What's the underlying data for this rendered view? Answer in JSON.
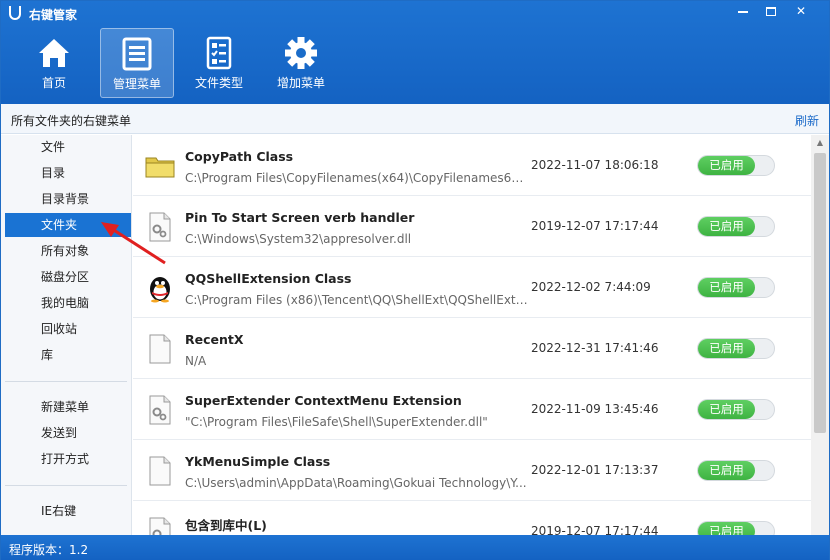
{
  "app": {
    "title": "右键管家"
  },
  "toolbar": {
    "items": [
      {
        "label": "首页",
        "icon": "home-icon"
      },
      {
        "label": "管理菜单",
        "icon": "menu-list-icon",
        "active": true
      },
      {
        "label": "文件类型",
        "icon": "file-type-icon"
      },
      {
        "label": "增加菜单",
        "icon": "gear-icon"
      }
    ]
  },
  "subheader": {
    "title": "所有文件夹的右键菜单",
    "refresh": "刷新"
  },
  "sidebar": {
    "group1": [
      "文件",
      "目录",
      "目录背景",
      "文件夹",
      "所有对象",
      "磁盘分区",
      "我的电脑",
      "回收站",
      "库"
    ],
    "selected": "文件夹",
    "group2": [
      "新建菜单",
      "发送到",
      "打开方式"
    ],
    "group3": [
      "IE右键"
    ]
  },
  "list": {
    "rows": [
      {
        "name": "CopyPath Class",
        "path": "C:\\Program Files\\CopyFilenames(x64)\\CopyFilenames64.o...",
        "date": "2022-11-07 18:06:18",
        "status": "已启用",
        "icon": "folder-icon"
      },
      {
        "name": "Pin To Start Screen verb handler",
        "path": "C:\\Windows\\System32\\appresolver.dll",
        "date": "2019-12-07 17:17:44",
        "status": "已启用",
        "icon": "dll-file-icon"
      },
      {
        "name": "QQShellExtension Class",
        "path": "C:\\Program Files (x86)\\Tencent\\QQ\\ShellExt\\QQShellExt6...",
        "date": "2022-12-02 7:44:09",
        "status": "已启用",
        "icon": "qq-penguin-icon"
      },
      {
        "name": "RecentX",
        "path": "N/A",
        "date": "2022-12-31 17:41:46",
        "status": "已启用",
        "icon": "blank-file-icon"
      },
      {
        "name": "SuperExtender ContextMenu Extension",
        "path": "\"C:\\Program Files\\FileSafe\\Shell\\SuperExtender.dll\"",
        "date": "2022-11-09 13:45:46",
        "status": "已启用",
        "icon": "dll-file-icon"
      },
      {
        "name": "YkMenuSimple Class",
        "path": "C:\\Users\\admin\\AppData\\Roaming\\Gokuai Technology\\Y...",
        "date": "2022-12-01 17:13:37",
        "status": "已启用",
        "icon": "blank-file-icon"
      },
      {
        "name": "包含到库中(L)",
        "path": "",
        "date": "2019-12-07 17:17:44",
        "status": "已启用",
        "icon": "dll-file-icon"
      }
    ]
  },
  "statusbar": {
    "version": "程序版本：1.2"
  },
  "colors": {
    "brand_blue": "#1a6fd0",
    "enabled_green": "#44b848",
    "selected_blue": "#1a73d3",
    "annotation_red": "#e02020"
  }
}
